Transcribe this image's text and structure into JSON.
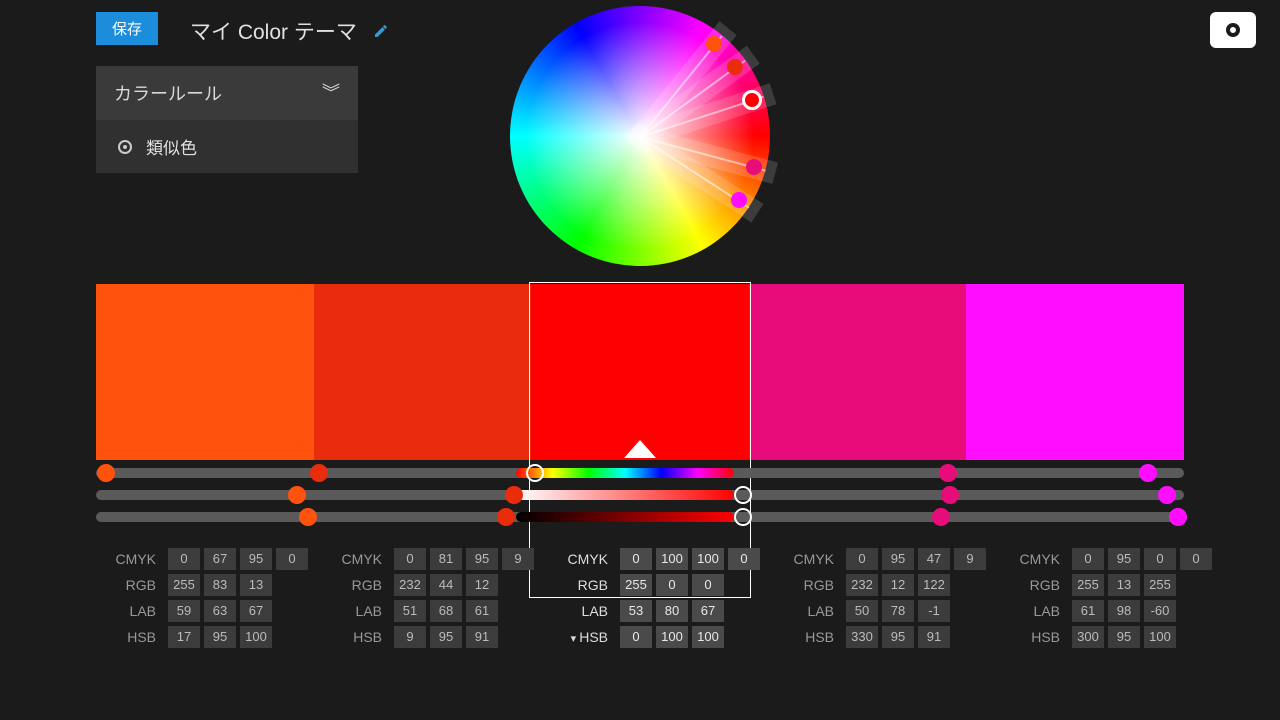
{
  "header": {
    "save_label": "保存",
    "title": "マイ Color テーマ"
  },
  "rule_panel": {
    "header": "カラールール",
    "selected": "類似色"
  },
  "swatches": [
    {
      "hex": "#FF530D",
      "cmyk": [
        0,
        67,
        95,
        0
      ],
      "rgb": [
        255,
        83,
        13
      ],
      "lab": [
        59,
        63,
        67
      ],
      "hsb": [
        17,
        95,
        100
      ]
    },
    {
      "hex": "#E82C0C",
      "cmyk": [
        0,
        81,
        95,
        9
      ],
      "rgb": [
        232,
        44,
        12
      ],
      "lab": [
        51,
        68,
        61
      ],
      "hsb": [
        9,
        95,
        91
      ]
    },
    {
      "hex": "#FF0000",
      "cmyk": [
        0,
        100,
        100,
        0
      ],
      "rgb": [
        255,
        0,
        0
      ],
      "lab": [
        53,
        80,
        67
      ],
      "hsb": [
        0,
        100,
        100
      ],
      "selected": true
    },
    {
      "hex": "#E80C7A",
      "cmyk": [
        0,
        95,
        47,
        9
      ],
      "rgb": [
        232,
        12,
        122
      ],
      "lab": [
        50,
        78,
        -1
      ],
      "hsb": [
        330,
        95,
        91
      ]
    },
    {
      "hex": "#FF0DFF",
      "cmyk": [
        0,
        95,
        0,
        0
      ],
      "rgb": [
        255,
        13,
        255
      ],
      "lab": [
        61,
        98,
        -60
      ],
      "hsb": [
        300,
        95,
        100
      ]
    }
  ],
  "wheel_points": [
    {
      "angle_deg": -51,
      "color": "#FF530D"
    },
    {
      "angle_deg": -36,
      "color": "#E82C0C"
    },
    {
      "angle_deg": -18,
      "color": "#FF0000",
      "active": true
    },
    {
      "angle_deg": 15,
      "color": "#E80C7A"
    },
    {
      "angle_deg": 33,
      "color": "#FF0DFF"
    }
  ],
  "slider_rows": [
    "hue",
    "saturation",
    "brightness"
  ],
  "value_labels": {
    "cmyk": "CMYK",
    "rgb": "RGB",
    "lab": "LAB",
    "hsb": "HSB"
  }
}
